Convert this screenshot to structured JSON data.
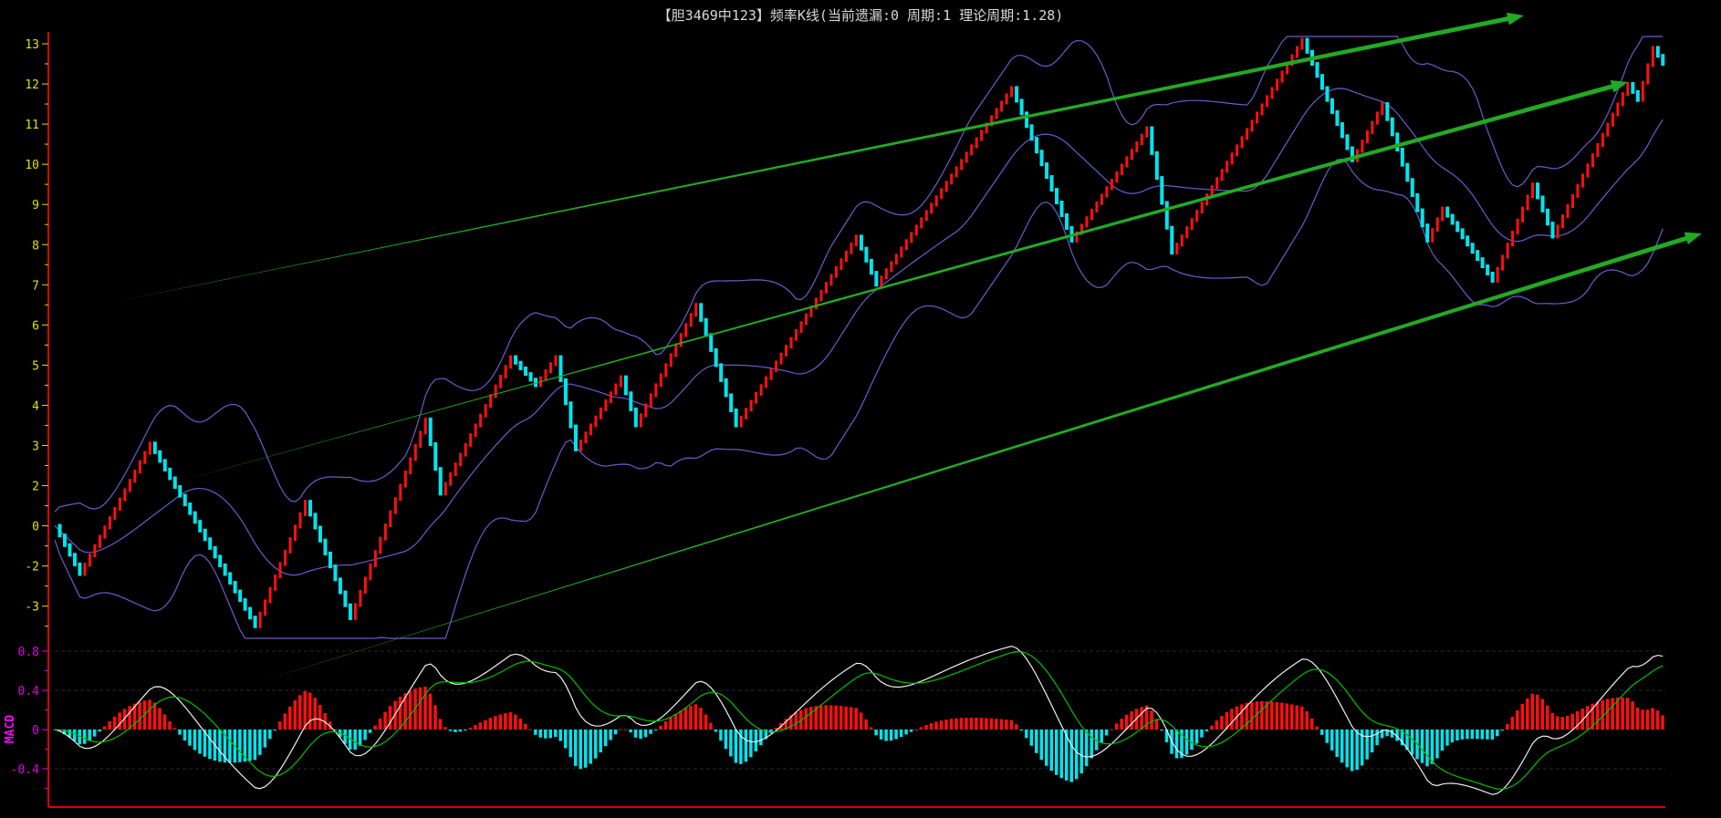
{
  "title": "【胆3469中123】频率K线(当前遗漏:0 周期:1 理论周期:1.28)",
  "colors": {
    "axis": "#dd0000",
    "up": "#ff1010",
    "down": "#00e5ee",
    "band": "#6a5ccc",
    "trend": "#22aa22",
    "main_tick": "#e0e000",
    "macd_tick": "#e000e0",
    "dif": "#f0f0f0",
    "dea": "#00c000"
  },
  "chart_data": [
    {
      "type": "candlestick",
      "title": "频率K线",
      "ylim": [
        -1.5,
        13.3
      ],
      "y_ticks": [
        {
          "value": 13,
          "label": "13"
        },
        {
          "value": 12,
          "label": "12"
        },
        {
          "value": 11,
          "label": "11"
        },
        {
          "value": 10,
          "label": "10"
        },
        {
          "value": 9,
          "label": "9"
        },
        {
          "value": 8,
          "label": "8"
        },
        {
          "value": 7,
          "label": "7"
        },
        {
          "value": 6,
          "label": "6"
        },
        {
          "value": 5,
          "label": "5"
        },
        {
          "value": 4,
          "label": "4"
        },
        {
          "value": 3,
          "label": "3"
        },
        {
          "value": 2,
          "label": "2"
        },
        {
          "value": 1,
          "label": "0"
        },
        {
          "value": 0,
          "label": "-2"
        },
        {
          "value": -1,
          "label": "-3"
        }
      ],
      "bar_count": 322,
      "pivots": [
        [
          0,
          1.0
        ],
        [
          5,
          -0.2
        ],
        [
          19,
          3.05
        ],
        [
          40,
          -1.5
        ],
        [
          50,
          1.6
        ],
        [
          59,
          -1.3
        ],
        [
          74,
          3.65
        ],
        [
          77,
          1.8
        ],
        [
          91,
          5.2
        ],
        [
          96,
          4.5
        ],
        [
          100,
          5.2
        ],
        [
          104,
          2.9
        ],
        [
          113,
          4.7
        ],
        [
          116,
          3.5
        ],
        [
          128,
          6.5
        ],
        [
          136,
          3.5
        ],
        [
          160,
          8.2
        ],
        [
          164,
          7.0
        ],
        [
          191,
          11.9
        ],
        [
          203,
          8.1
        ],
        [
          218,
          10.9
        ],
        [
          223,
          7.8
        ],
        [
          249,
          13.1
        ],
        [
          259,
          10.1
        ],
        [
          265,
          11.5
        ],
        [
          274,
          8.1
        ],
        [
          277,
          8.9
        ],
        [
          287,
          7.1
        ],
        [
          295,
          9.5
        ],
        [
          299,
          8.2
        ],
        [
          314,
          12.0
        ],
        [
          316,
          11.6
        ],
        [
          319,
          12.9
        ],
        [
          321,
          12.5
        ]
      ],
      "overlays": [
        "bollinger upper",
        "bollinger middle",
        "bollinger lower"
      ]
    },
    {
      "type": "macd",
      "ylabel": "MACD",
      "ylim": [
        -0.65,
        0.95
      ],
      "y_ticks": [
        {
          "value": 0.8,
          "label": "0.8"
        },
        {
          "value": 0.4,
          "label": "0.4"
        },
        {
          "value": 0,
          "label": "0"
        },
        {
          "value": -0.4,
          "label": "-0.4"
        }
      ],
      "series": [
        {
          "name": "DIF"
        },
        {
          "name": "DEA"
        },
        {
          "name": "MACD histogram"
        }
      ]
    }
  ]
}
